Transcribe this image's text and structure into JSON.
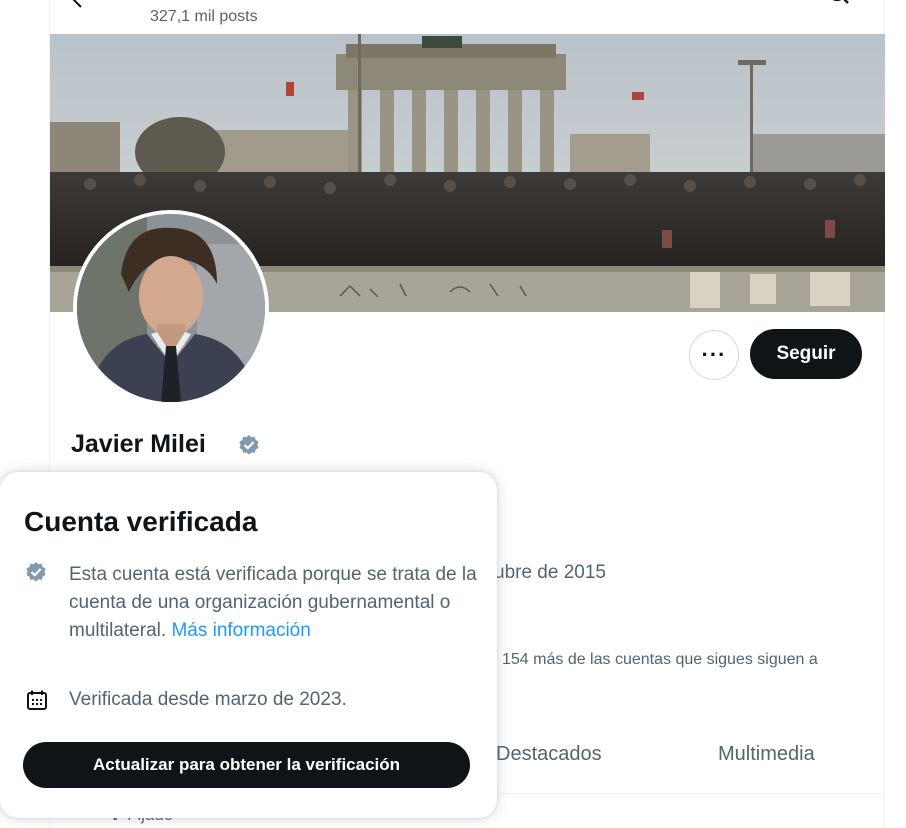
{
  "header": {
    "posts_count": "327,1 mil posts"
  },
  "profile": {
    "name": "Javier Milei",
    "follow_label": "Seguir",
    "more_label": "···",
    "joined_partial": "ubre de 2015",
    "followers_you_know_partial": "154 más de las cuentas que sigues siguen a"
  },
  "tabs": [
    {
      "label": "Destacados"
    },
    {
      "label": "Multimedia"
    }
  ],
  "pinned": {
    "label": "Fijado"
  },
  "popover": {
    "title": "Cuenta verificada",
    "description": "Esta cuenta está verificada porque se trata de la cuenta de una organización gubernamental o multilateral.",
    "more_info": "Más información",
    "verified_since": "Verificada desde marzo de 2023.",
    "upgrade_button": "Actualizar para obtener la verificación"
  },
  "colors": {
    "text_primary": "#0f1419",
    "text_secondary": "#536471",
    "link": "#1d9bf0",
    "badge_gray": "#829aab",
    "button_dark": "#0f1419"
  },
  "icons": {
    "back": "arrow-left-icon",
    "search": "search-icon",
    "verified": "verified-badge-icon",
    "calendar": "calendar-icon"
  }
}
